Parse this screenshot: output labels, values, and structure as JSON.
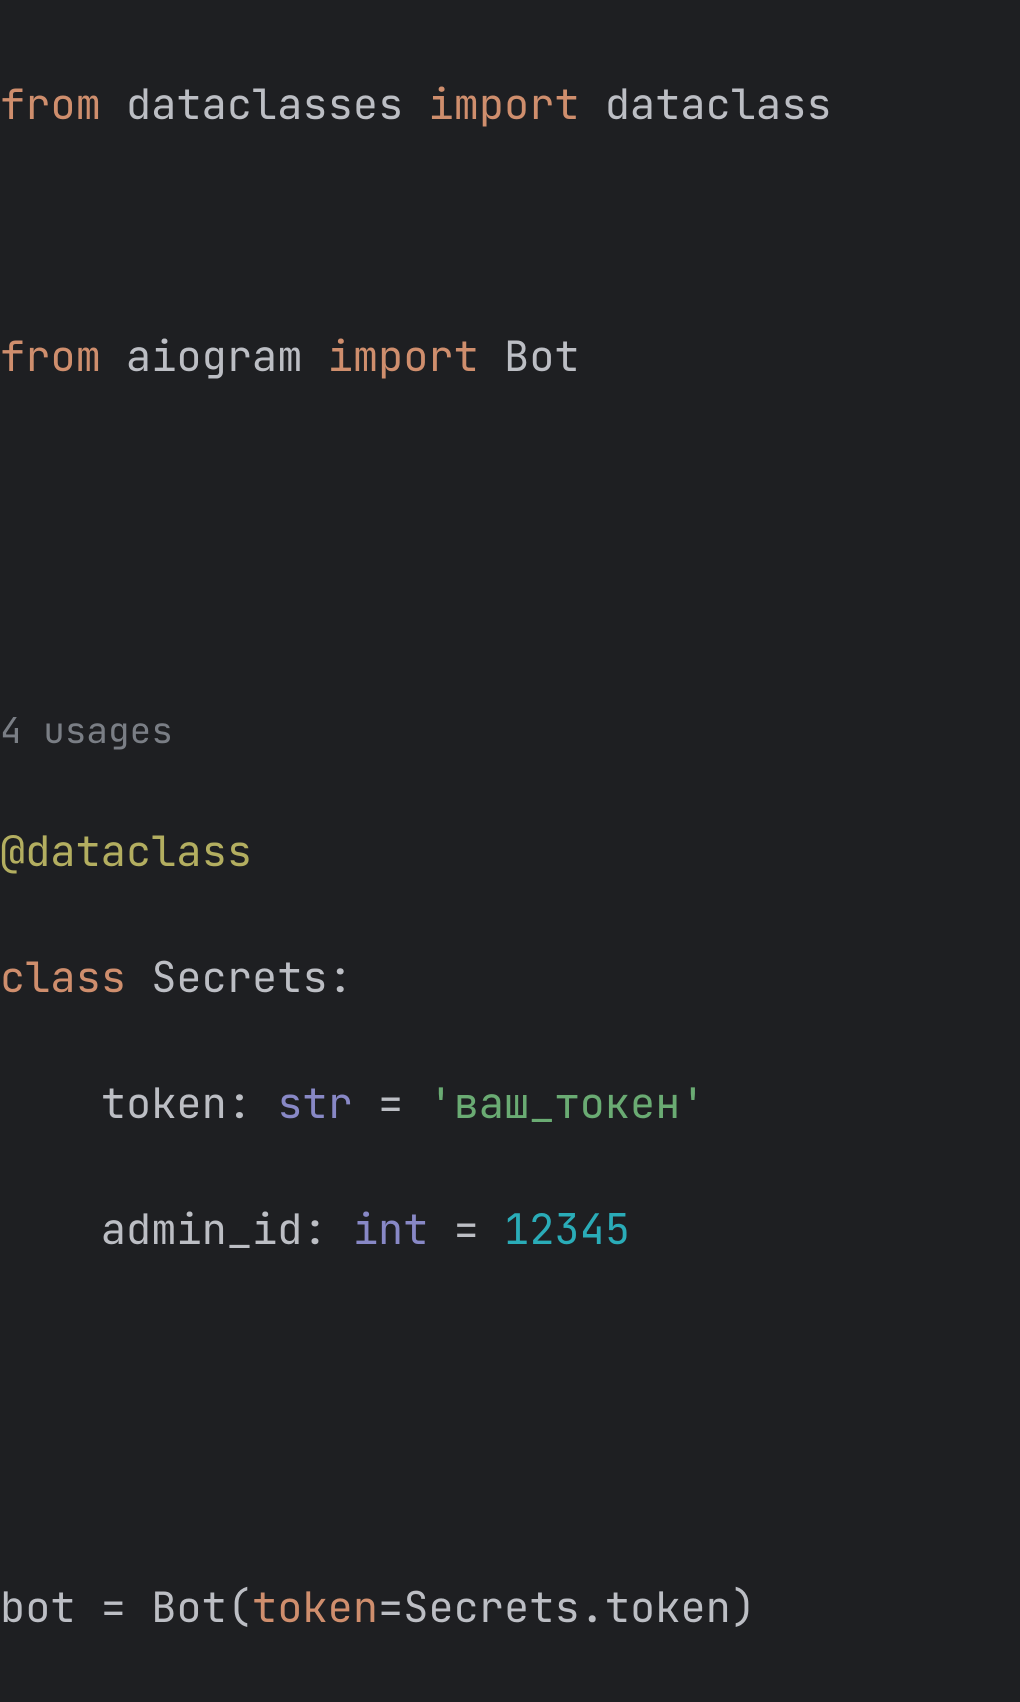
{
  "code": {
    "line1": {
      "from": "from",
      "module": "dataclasses",
      "import": "import",
      "name": "dataclass"
    },
    "line3": {
      "from": "from",
      "module": "aiogram",
      "import": "import",
      "name": "Bot"
    },
    "hint": "4 usages",
    "decorator": "@dataclass",
    "line_class": {
      "class_kw": "class",
      "name": "Secrets",
      "colon": ":"
    },
    "line_token": {
      "indent": "    ",
      "name": "token",
      "colon": ": ",
      "type": "str",
      "eq": " = ",
      "value": "'ваш_токен'"
    },
    "line_admin": {
      "indent": "    ",
      "name": "admin_id",
      "colon": ": ",
      "type": "int",
      "eq": " = ",
      "value": "12345"
    },
    "line_bot": {
      "var": "bot",
      "eq": " = ",
      "cls": "Bot",
      "open": "(",
      "kwarg": "token",
      "assign": "=",
      "val": "Secrets.token",
      "close": ")"
    }
  }
}
